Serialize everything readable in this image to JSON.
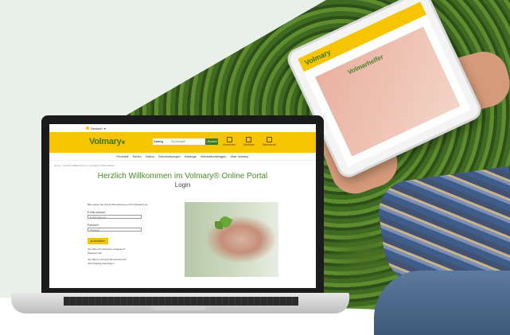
{
  "site": {
    "lang_label": "Deutsch",
    "logo_text": "Volmary",
    "search": {
      "category": "Katalog",
      "placeholder": "Suchbegriff",
      "button": "Suchen"
    },
    "header_icons": [
      {
        "icon": "user-icon",
        "label": "Anmelden"
      },
      {
        "icon": "heart-icon",
        "label": "Merkliste"
      },
      {
        "icon": "cart-icon",
        "label": "Warenkorb"
      }
    ],
    "nav": [
      "Produkte",
      "Serien",
      "Videos",
      "Beschreibungen",
      "Kataloge",
      "Verkaufsunterlagen",
      "Über Volmary"
    ],
    "breadcrumb": "Home > Herzlich Willkommen im Volmary® Online Portal",
    "welcome": "Herzlich Willkommen im Volmary® Online Portal",
    "subtitle": "Login",
    "form": {
      "intro": "Bitte geben Sie Ihre E-Mail-Adresse und Ihr Passwort ein.",
      "email_label": "E-Mail-Adresse*",
      "email_placeholder": "E-Mail-Adresse",
      "password_label": "Passwort*",
      "password_placeholder": "Passwort",
      "login_button": "Anmelden",
      "forgot_q": "Sie haben Ihr Passwort vergessen?",
      "forgot_link": "Passwort hier",
      "no_account_q": "Sie haben noch kein Benutzerkonto?",
      "register_link": "Jetzt Zugang beantragen"
    }
  },
  "tablet": {
    "logo_text": "Volmary",
    "hero_text": "Volmarhelfer"
  },
  "colors": {
    "brand_yellow": "#f6c400",
    "brand_green": "#4b8a24",
    "mint_bg": "#e9f0ea"
  }
}
